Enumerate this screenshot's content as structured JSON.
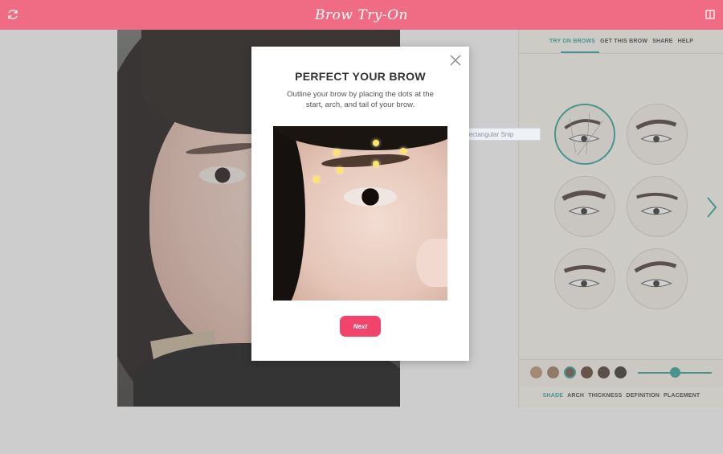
{
  "app": {
    "title": "Brow Try-On"
  },
  "icons": {
    "refresh": "refresh-icon",
    "panel": "panel-toggle-icon",
    "close": "close-icon",
    "next": "chevron-right-icon"
  },
  "top_tabs": [
    {
      "label": "TRY ON BROWS",
      "active": true
    },
    {
      "label": "GET THIS BROW",
      "active": false
    },
    {
      "label": "SHARE",
      "active": false
    },
    {
      "label": "HELP",
      "active": false
    }
  ],
  "bottom_tabs": [
    {
      "label": "SHADE",
      "active": true
    },
    {
      "label": "ARCH",
      "active": false
    },
    {
      "label": "THICKNESS",
      "active": false
    },
    {
      "label": "DEFINITION",
      "active": false
    },
    {
      "label": "PLACEMENT",
      "active": false
    }
  ],
  "brow_shapes": [
    {
      "id": "shape-1",
      "selected": true
    },
    {
      "id": "shape-2",
      "selected": false
    },
    {
      "id": "shape-3",
      "selected": false
    },
    {
      "id": "shape-4",
      "selected": false
    },
    {
      "id": "shape-5",
      "selected": false
    },
    {
      "id": "shape-6",
      "selected": false
    }
  ],
  "shades": [
    {
      "color": "#b89473",
      "selected": false
    },
    {
      "color": "#9a7b62",
      "selected": false
    },
    {
      "color": "#6e5647",
      "selected": true
    },
    {
      "color": "#5c4235",
      "selected": false
    },
    {
      "color": "#4a3930",
      "selected": false
    },
    {
      "color": "#3a302c",
      "selected": false
    }
  ],
  "intensity_slider": {
    "value": 0.5
  },
  "modal": {
    "title": "PERFECT YOUR BROW",
    "instructions": "Outline your brow by placing the dots at the start, arch, and tail of your brow.",
    "next_label": "Next"
  },
  "snip_tooltip": {
    "label": "Rectangular Snip"
  },
  "colors": {
    "brand": "#f06b84",
    "accent": "#2fa39a",
    "button": "#f2446b",
    "dot": "#ffe46a"
  }
}
